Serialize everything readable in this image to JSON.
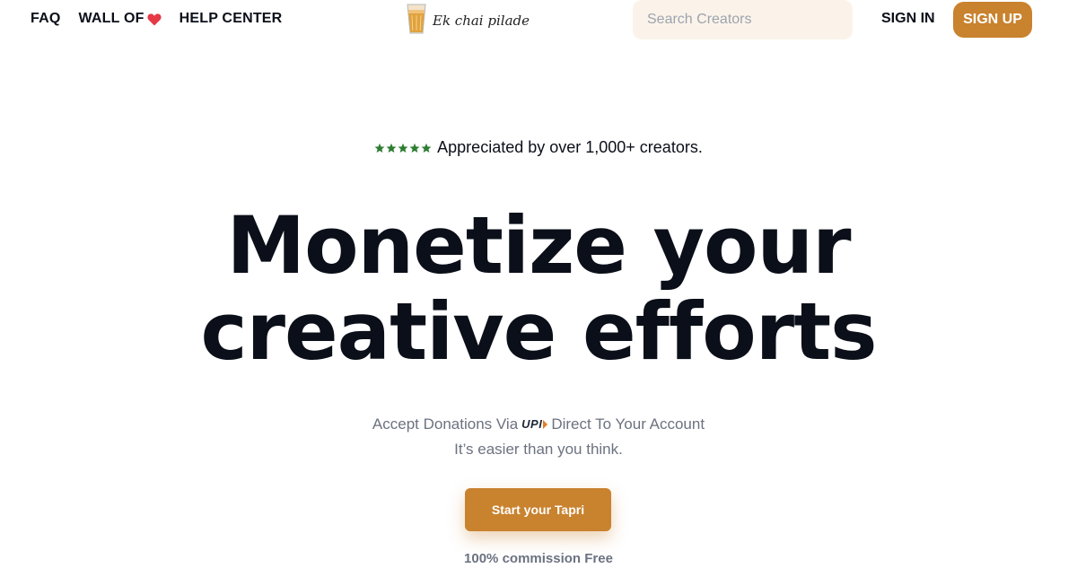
{
  "nav": {
    "faq": "FAQ",
    "wall_of": "WALL OF",
    "help_center": "HELP CENTER",
    "logo_text": "Ek chai pilade",
    "search_placeholder": "Search Creators",
    "sign_in": "SIGN IN",
    "sign_up": "SIGN UP"
  },
  "hero": {
    "stars_count": 5,
    "rating_text": "Appreciated by over 1,000+ creators.",
    "headline_line1": "Monetize your",
    "headline_line2": "creative efforts",
    "sub_before": "Accept Donations Via",
    "upi_label": "UPI",
    "sub_after": "Direct To Your Account",
    "sub_line2": "It’s easier than you think.",
    "cta_label": "Start your Tapri",
    "commission": "100% commission Free"
  },
  "colors": {
    "accent": "#c9822e",
    "search_bg": "#fbf3e9",
    "star": "#2e7d32",
    "heart": "#e53945",
    "text_dark": "#0b0f19",
    "text_muted": "#6b7280"
  },
  "icons": {
    "heart": "heart-icon",
    "logo": "chai-glass-icon",
    "star": "star-icon",
    "upi": "upi-logo-icon"
  }
}
